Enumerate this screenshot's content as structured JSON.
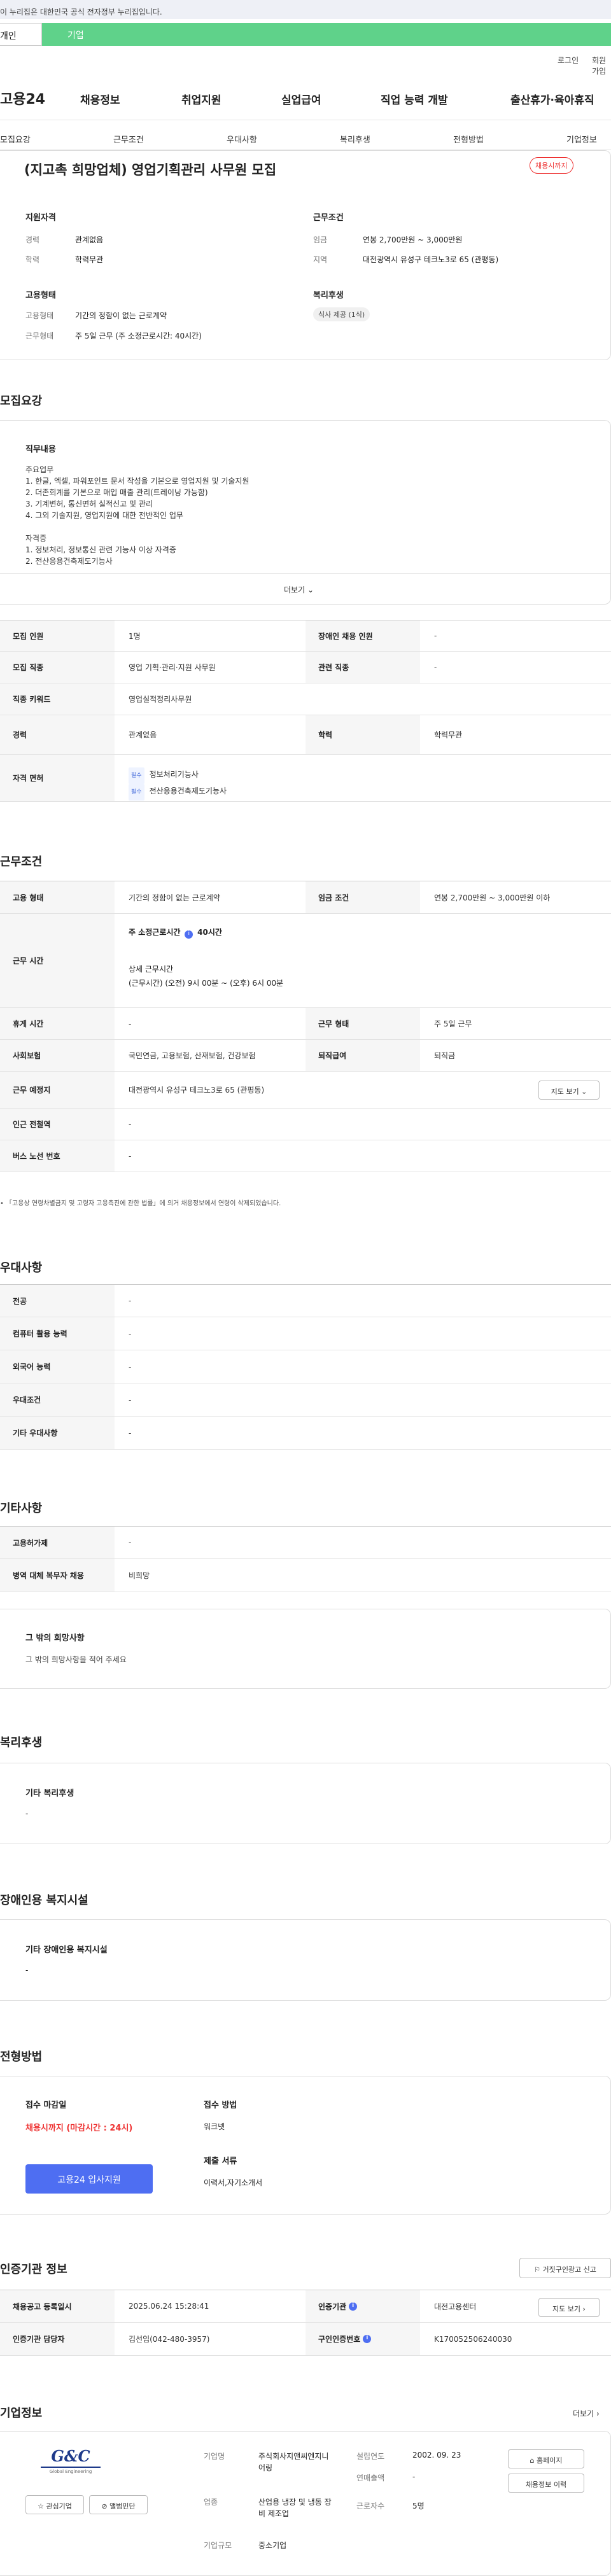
{
  "banner": {
    "text": "이 누리집은 대한민국 공식 전자정부 누리집입니다."
  },
  "tabs": [
    "개인",
    "기업"
  ],
  "util": [
    "로그인",
    "회원가입"
  ],
  "logo": "고용24",
  "gnav": [
    "채용정보",
    "취업지원",
    "실업급여",
    "직업 능력 개발",
    "출산휴가·육아휴직"
  ],
  "subnav": [
    "모집요강",
    "근무조건",
    "우대사항",
    "복리후생",
    "전형방법",
    "기업정보"
  ],
  "summary": {
    "title": "(지고촉 희망업체) 영업기획관리 사무원 모집",
    "status": "채용시까지",
    "qual_title": "지원자격",
    "qual": [
      [
        "경력",
        "관계없음"
      ],
      [
        "학력",
        "학력무관"
      ]
    ],
    "emp_title": "고용형태",
    "emp": [
      [
        "고용형태",
        "기간의 정함이 없는 근로계약"
      ],
      [
        "근무형태",
        "주 5일 근무 (주 소정근로시간: 40시간)"
      ]
    ],
    "cond_title": "근무조건",
    "cond": [
      [
        "임금",
        "연봉 2,700만원 ~ 3,000만원"
      ],
      [
        "지역",
        "대전광역시 유성구 테크노3로 65 (관평동)"
      ]
    ],
    "welfare_title": "복리후생",
    "welfare_pill": "식사 제공 (1식)"
  },
  "recruit": {
    "heading": "모집요강",
    "box_title": "직무내용",
    "lines": [
      "주요업무",
      "1. 한글, 엑셀, 파워포인트 문서 작성을 기본으로 영업지원 및 기술지원",
      "2. 더존회계를 기본으로 매입 매출 관리(트레이닝 가능함)",
      "3. 기계변허, 통신면허 실적신고 및 관리",
      "4. 그외 기술지원, 영업지원에 대한 전반적인 업무",
      "",
      "자격증",
      "1. 정보처리, 정보통신 관련 기능사 이상 자격증",
      "2. 전산응용건축제도기능사"
    ],
    "more": "더보기"
  },
  "rtable": {
    "r1": [
      "모집 인원",
      "1명",
      "장애인 채용 인원",
      "-"
    ],
    "r2": [
      "모집 직종",
      "영업 기획·관리·지원 사무원",
      "관련 직종",
      "-"
    ],
    "r3": [
      "직종 키워드",
      "영업실적정리사무원"
    ],
    "r4": [
      "경력",
      "관계없음",
      "학력",
      "학력무관"
    ],
    "r5": {
      "th": "자격 면허",
      "tag": "필수",
      "items": [
        "정보처리기능사",
        "전산응용건축제도기능사"
      ]
    }
  },
  "work": {
    "heading": "근무조건",
    "r1": [
      "고용 형태",
      "기간의 정함이 없는 근로계약",
      "임금 조건",
      "연봉 2,700만원 ~ 3,000만원 이하"
    ],
    "r2": {
      "th": "근무 시간",
      "a": "주 소정근로시간",
      "a2": "40시간",
      "b": "상세 근무시간",
      "c": "(근무시간) (오전) 9시 00분 ~ (오후) 6시 00분"
    },
    "r3": [
      "휴게 시간",
      "-",
      "근무 형태",
      "주 5일 근무"
    ],
    "r4": [
      "사회보험",
      "국민연금, 고용보험, 산재보험, 건강보험",
      "퇴직급여",
      "퇴직금"
    ],
    "r5": [
      "근무 예정지",
      "대전광역시 유성구 테크노3로 65 (관평동)",
      "지도 보기"
    ],
    "r6": [
      "인근 전철역",
      "-"
    ],
    "r7": [
      "버스 노선 번호",
      "-"
    ],
    "note": "「고용상 연령차별금지 및 고령자 고용촉진에 관한 법률」에 의거 채용정보에서 연령이 삭제되었습니다."
  },
  "pref": {
    "heading": "우대사항",
    "rows": [
      [
        "전공",
        "-"
      ],
      [
        "컴퓨터 활용 능력",
        "-"
      ],
      [
        "외국어 능력",
        "-"
      ],
      [
        "우대조건",
        "-"
      ],
      [
        "기타 우대사항",
        "-"
      ]
    ]
  },
  "other": {
    "heading": "기타사항",
    "rows": [
      [
        "고용허가제",
        "-"
      ],
      [
        "병역 대체 복무자 채용",
        "비희망"
      ]
    ],
    "box_title": "그 밖의 희망사항",
    "box_text": "그 밖의 희망사항을 적어 주세요"
  },
  "benefit": {
    "heading": "복리후생",
    "title": "기타 복리후생",
    "text": "-"
  },
  "disabled": {
    "heading": "장애인용 복지시설",
    "title": "기타 장애인용 복지시설",
    "text": "-"
  },
  "process": {
    "heading": "전형방법",
    "deadline_label": "접수 마감일",
    "deadline": "채용시까지 (마감시간 : 24시)",
    "method_label": "접수 방법",
    "method": "워크넷",
    "docs_label": "제출 서류",
    "docs": "이력서,자기소개서",
    "apply": "고용24 입사지원"
  },
  "agency": {
    "heading": "인증기관 정보",
    "report": "거짓구인광고 신고",
    "r1": [
      "채용공고 등록일시",
      "2025.06.24 15:28:41",
      "인증기관",
      "대전고용센터",
      "지도 보기"
    ],
    "r2": [
      "인증기관 담당자",
      "김선임(042-480-3957)",
      "구인인증번호",
      "K170052506240030"
    ]
  },
  "company": {
    "heading": "기업정보",
    "more": "더보기",
    "logo": "G&C",
    "logo_sub": "Global Engineering",
    "fav": "관심기업",
    "photo": "앨범민단",
    "name_l": "기업명",
    "name": "주식회사지앤씨엔지니어링",
    "est_l": "설립연도",
    "est": "2002. 09. 23",
    "sales_l": "연매출액",
    "sales": "-",
    "biz_l": "업종",
    "biz": "산업용 냉장 및 냉동 장비 제조업",
    "emp_l": "근로자수",
    "emp": "5명",
    "size_l": "기업규모",
    "size": "중소기업",
    "home": "홈페이지",
    "info": "채용정보 이력"
  }
}
